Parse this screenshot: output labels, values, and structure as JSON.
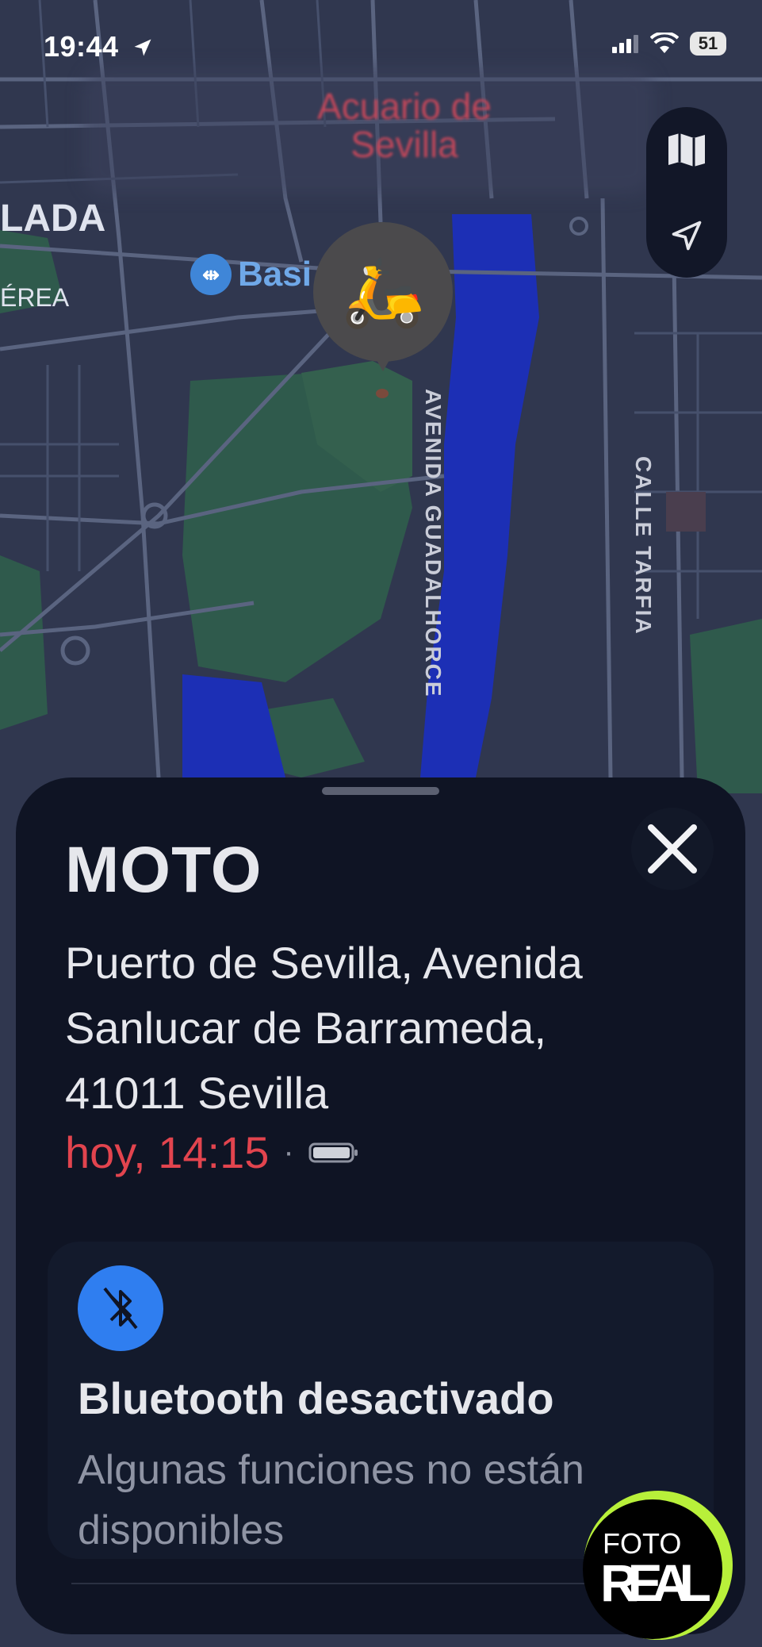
{
  "status_bar": {
    "time": "19:44",
    "battery": "51"
  },
  "map": {
    "blurred_poi": "Acuario de Sevilla",
    "labels": {
      "lada": "LADA",
      "aerea": "ÉREA",
      "basi": "Basi",
      "avenida": "AVENIDA GUADALHORCE",
      "calle": "CALLE TARFIA"
    }
  },
  "map_controls": {
    "map_icon": "map-icon",
    "locate_icon": "location-arrow-icon"
  },
  "pin": {
    "emoji": "🛵"
  },
  "sheet": {
    "title": "MOTO",
    "address_lines": [
      "Puerto de Sevilla, Avenida",
      "Sanlucar de Barrameda,",
      "41011 Sevilla"
    ],
    "last_seen": "hoy, 14:15",
    "separator": "·",
    "bluetooth": {
      "title": "Bluetooth desactivado",
      "subtitle": "Algunas funciones no están disponibles"
    }
  },
  "badge": {
    "line1": "FOTO",
    "line2": "REAL"
  },
  "colors": {
    "accent_red": "#e2444e",
    "bluetooth_blue": "#2f7ef0",
    "badge_green": "#b8f03a"
  }
}
